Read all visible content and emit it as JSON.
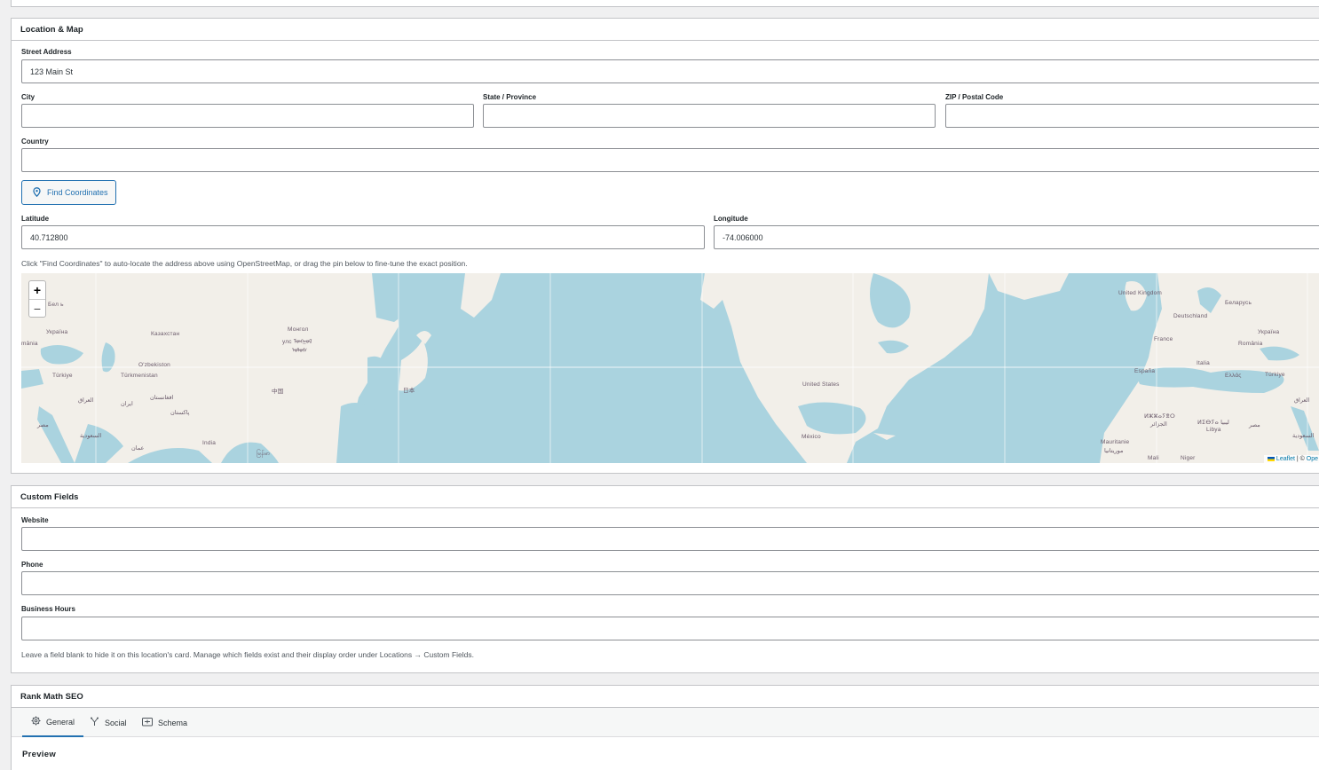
{
  "location_box": {
    "title": "Location & Map",
    "street_label": "Street Address",
    "street_value": "123 Main St",
    "city_label": "City",
    "city_value": "",
    "state_label": "State / Province",
    "state_value": "",
    "zip_label": "ZIP / Postal Code",
    "zip_value": "",
    "country_label": "Country",
    "country_value": "",
    "find_button": "Find Coordinates",
    "latitude_label": "Latitude",
    "latitude_value": "40.712800",
    "longitude_label": "Longitude",
    "longitude_value": "-74.006000",
    "hint": "Click \"Find Coordinates\" to auto-locate the address above using OpenStreetMap, or drag the pin below to fine-tune the exact position."
  },
  "map": {
    "zoom_in": "+",
    "zoom_out": "−",
    "attribution_leaflet": "Leaflet",
    "attribution_sep": " | © ",
    "attribution_osm": "Ope",
    "labels": {
      "ukraine_left": "Україна",
      "romania_left": "mânia",
      "kazakhstan": "Казахстан",
      "uzbekistan": "O'zbekiston",
      "turkmenistan": "Türkmenistan",
      "turkiye_left": "Türkiye",
      "iraq_left": "العراق",
      "iran": "ایران",
      "afghanistan": "افغانستان",
      "pakistan": "پاکستان",
      "egypt_left": "مصر",
      "saudi_left": "السعودية",
      "oman": "عمان",
      "india": "India",
      "mongolia": "Монгол",
      "mongolia2": "улс ᠮᠣᠩᠭᠣᠯ",
      "mongolia3": "ᠤᠯᠤᠰ",
      "china": "中国",
      "japan": "日本",
      "myanmar": "မြန်မာ",
      "united_states": "United States",
      "mexico": "México",
      "united_kingdom": "United Kingdom",
      "belarus": "Беларусь",
      "deutschland": "Deutschland",
      "ukraine_right": "Україна",
      "france": "France",
      "romania_right": "România",
      "italia": "Italia",
      "espana": "España",
      "greece": "Ελλάς",
      "turkiye_right": "Türkiye",
      "iraq_right": "العراق",
      "algeria": "ⵍⵣⵣⴰⵢⴻⵔ",
      "algeria2": "الجزائر",
      "libya": "ⵍⵉⴱⵢⴰ ليبيا",
      "libya2": "Libya",
      "egypt_right": "مصر",
      "saudi_right": "السعودية",
      "mauritanie": "Mauritanie",
      "mauritanie2": "موريتانيا",
      "mali": "Mali",
      "niger": "Niger",
      "be_left": "Бел ь"
    }
  },
  "custom_box": {
    "title": "Custom Fields",
    "website_label": "Website",
    "website_value": "",
    "phone_label": "Phone",
    "phone_value": "",
    "hours_label": "Business Hours",
    "hours_value": "",
    "hint": "Leave a field blank to hide it on this location's card. Manage which fields exist and their display order under Locations → Custom Fields."
  },
  "seo_box": {
    "title": "Rank Math SEO",
    "tabs": [
      {
        "label": "General",
        "icon": "gear-icon"
      },
      {
        "label": "Social",
        "icon": "share-icon"
      },
      {
        "label": "Schema",
        "icon": "schema-icon"
      }
    ],
    "active_tab": "General",
    "preview_label": "Preview"
  },
  "colors": {
    "accent": "#2271b1",
    "water": "#aad3df",
    "land": "#f2efe9"
  }
}
